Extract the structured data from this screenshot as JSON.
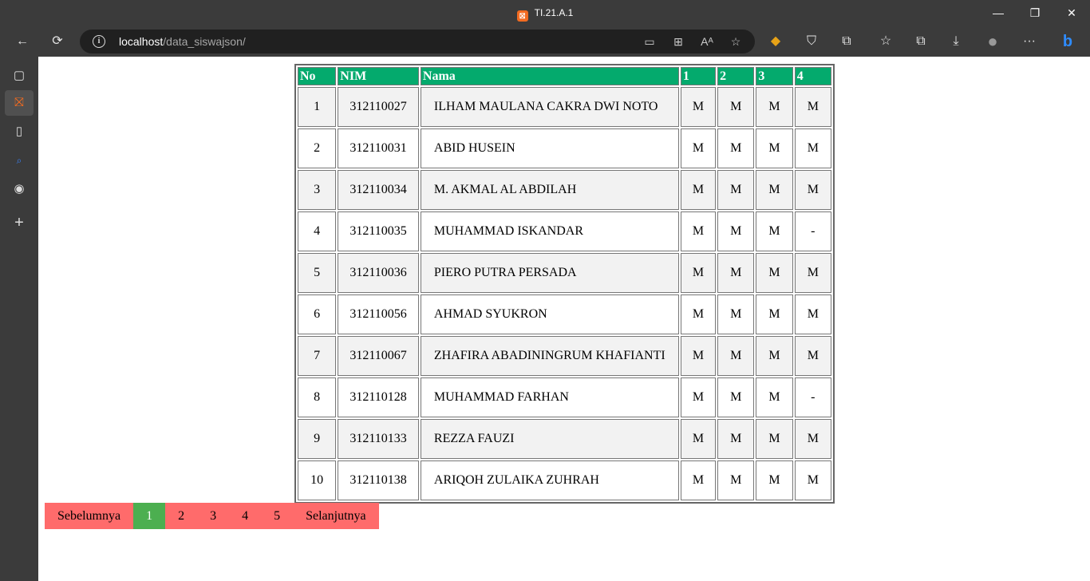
{
  "window": {
    "title": "TI.21.A.1",
    "minimize": "—",
    "restore": "❐",
    "close": "✕"
  },
  "toolbar": {
    "back": "←",
    "refresh": "⟳",
    "url_host": "localhost",
    "url_path": "/data_siswajson/",
    "icons": {
      "screen": "▭",
      "apps": "⊞",
      "read": "Aᴬ",
      "fav_add": "☆",
      "ext1": "◆",
      "ext2": "⛉",
      "extensions": "⧉",
      "favorites": "☆",
      "collections": "⧉",
      "download": "⤓",
      "profile": "●",
      "more": "···",
      "bing": "b"
    }
  },
  "sidebar": {
    "items": [
      "▢",
      "⛝",
      "▯",
      "⌕",
      "◉",
      "+"
    ]
  },
  "table": {
    "headers": [
      "No",
      "NIM",
      "Nama",
      "1",
      "2",
      "3",
      "4"
    ],
    "rows": [
      {
        "no": "1",
        "nim": "312110027",
        "nama": "ILHAM MAULANA CAKRA DWI NOTO",
        "c1": "M",
        "c2": "M",
        "c3": "M",
        "c4": "M"
      },
      {
        "no": "2",
        "nim": "312110031",
        "nama": "ABID HUSEIN",
        "c1": "M",
        "c2": "M",
        "c3": "M",
        "c4": "M"
      },
      {
        "no": "3",
        "nim": "312110034",
        "nama": "M. AKMAL AL ABDILAH",
        "c1": "M",
        "c2": "M",
        "c3": "M",
        "c4": "M"
      },
      {
        "no": "4",
        "nim": "312110035",
        "nama": "MUHAMMAD ISKANDAR",
        "c1": "M",
        "c2": "M",
        "c3": "M",
        "c4": "-"
      },
      {
        "no": "5",
        "nim": "312110036",
        "nama": "PIERO PUTRA PERSADA",
        "c1": "M",
        "c2": "M",
        "c3": "M",
        "c4": "M"
      },
      {
        "no": "6",
        "nim": "312110056",
        "nama": "AHMAD SYUKRON",
        "c1": "M",
        "c2": "M",
        "c3": "M",
        "c4": "M"
      },
      {
        "no": "7",
        "nim": "312110067",
        "nama": "ZHAFIRA ABADININGRUM KHAFIANTI",
        "c1": "M",
        "c2": "M",
        "c3": "M",
        "c4": "M"
      },
      {
        "no": "8",
        "nim": "312110128",
        "nama": "MUHAMMAD FARHAN",
        "c1": "M",
        "c2": "M",
        "c3": "M",
        "c4": "-"
      },
      {
        "no": "9",
        "nim": "312110133",
        "nama": "REZZA FAUZI",
        "c1": "M",
        "c2": "M",
        "c3": "M",
        "c4": "M"
      },
      {
        "no": "10",
        "nim": "312110138",
        "nama": "ARIQOH ZULAIKA ZUHRAH",
        "c1": "M",
        "c2": "M",
        "c3": "M",
        "c4": "M"
      }
    ]
  },
  "pagination": {
    "prev": "Sebelumnya",
    "pages": [
      "1",
      "2",
      "3",
      "4",
      "5"
    ],
    "active": "1",
    "next": "Selanjutnya"
  },
  "colors": {
    "header_bg": "#04aa6d",
    "page_bg": "#ff6b6b",
    "page_active": "#4caf50",
    "chrome": "#3b3b3b"
  }
}
